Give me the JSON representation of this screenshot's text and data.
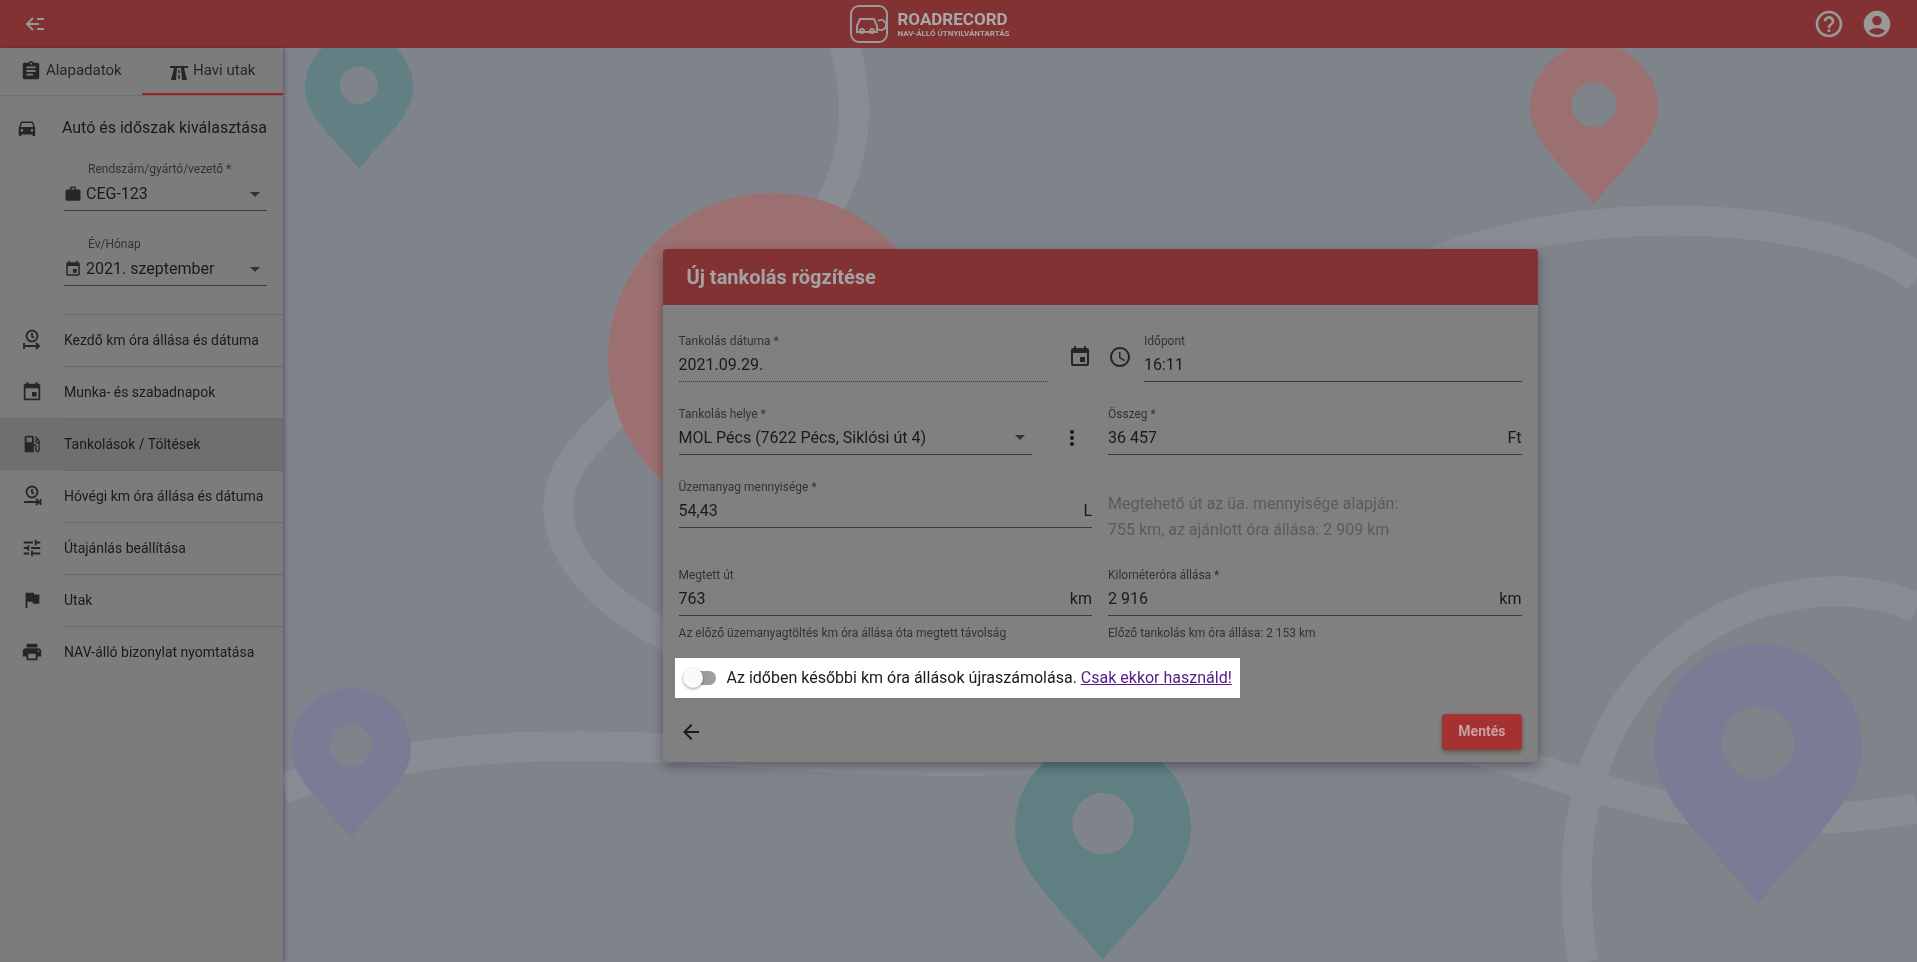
{
  "header": {
    "logo_title": "ROADRECORD",
    "logo_subtitle": "NAV-ÁLLÓ ÚTNYILVÁNTARTÁS"
  },
  "tabs": [
    {
      "label": "Alapadatok",
      "kind": "clipboard",
      "selected": false
    },
    {
      "label": "Havi utak",
      "kind": "road",
      "selected": true
    }
  ],
  "sidebar": {
    "section_title": "Autó és időszak kiválasztása",
    "selects": [
      {
        "label": "Rendszám/gyártó/vezető *",
        "value": "CEG-123",
        "kind": "briefcase"
      },
      {
        "label": "Év/Hónap",
        "value": "2021. szeptember",
        "kind": "calendar"
      }
    ],
    "items": [
      {
        "label": "Kezdő km óra állása és dátuma",
        "kind": "start",
        "selected": false
      },
      {
        "label": "Munka- és szabadnapok",
        "kind": "calendar",
        "selected": false
      },
      {
        "label": "Tankolások / Töltések",
        "kind": "fuel",
        "selected": true
      },
      {
        "label": "Hóvégi km óra állása és dátuma",
        "kind": "end",
        "selected": false
      },
      {
        "label": "Útajánlás beállítása",
        "kind": "tune",
        "selected": false
      },
      {
        "label": "Utak",
        "kind": "flag",
        "selected": false
      },
      {
        "label": "NAV-álló bizonylat nyomtatása",
        "kind": "print",
        "selected": false
      }
    ]
  },
  "dialog": {
    "title": "Új tankolás rögzítése",
    "fields": [
      {
        "kind": "date",
        "label": "Tankolás dátuma *",
        "value": "2021.09.29."
      },
      {
        "kind": "time",
        "label": "Időpont",
        "value": "16:11"
      },
      {
        "kind": "select",
        "label": "Tankolás helye *",
        "value": "MOL Pécs (7622 Pécs, Siklósi út 4)"
      },
      {
        "kind": "text",
        "label": "Összeg *",
        "value": "36 457",
        "suffix": "Ft"
      },
      {
        "kind": "text",
        "label": "Üzemanyag mennyisége *",
        "value": "54,43",
        "suffix": "L"
      },
      {
        "kind": "info",
        "lines": [
          "Megtehető út az üa. mennyisége alapján:",
          "755 km, az ajánlott óra állása: 2 909 km"
        ]
      },
      {
        "kind": "text",
        "label": "Megtett út",
        "value": "763",
        "suffix": "km",
        "helper": "Az előző üzemanyagtöltés km óra állása óta megtett távolság"
      },
      {
        "kind": "text",
        "label": "Kilométeróra állása *",
        "value": "2 916",
        "suffix": "km",
        "helper": "Előző tankolás km óra állása: 2 153 km"
      }
    ],
    "toggle": {
      "on": false,
      "text": "Az időben későbbi km óra állások újraszámolása.",
      "link": "Csak ekkor használd!"
    },
    "save_button": "Mentés"
  }
}
